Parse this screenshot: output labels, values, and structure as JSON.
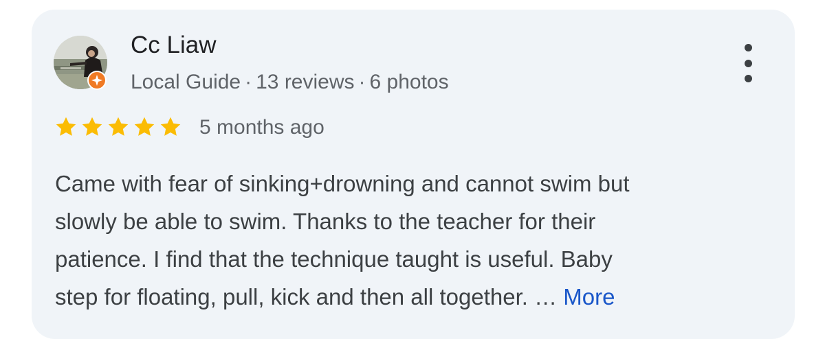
{
  "reviewer": {
    "name": "Cc Liaw",
    "badge": "Local Guide",
    "reviews": "13 reviews",
    "photos": "6 photos",
    "separator": "·"
  },
  "rating": {
    "stars": 5,
    "max": 5,
    "time": "5 months ago"
  },
  "review": {
    "lines": [
      "Came with fear of sinking+drowning and cannot swim but",
      "slowly be able to swim. Thanks to the teacher for their",
      "patience. I find that the technique taught is useful. Baby",
      "step for floating, pull, kick and then all together. …"
    ],
    "more_label": "More"
  },
  "icons": {
    "menu": "more-vertical-icon",
    "star": "star-icon",
    "guide_badge": "local-guide-badge-icon"
  },
  "colors": {
    "card_background": "#f0f4f8",
    "star": "#fbbc04",
    "link": "#1a57c9",
    "guide_badge": "#f07a24",
    "primary_text": "#202124",
    "secondary_text": "#5f6368"
  }
}
